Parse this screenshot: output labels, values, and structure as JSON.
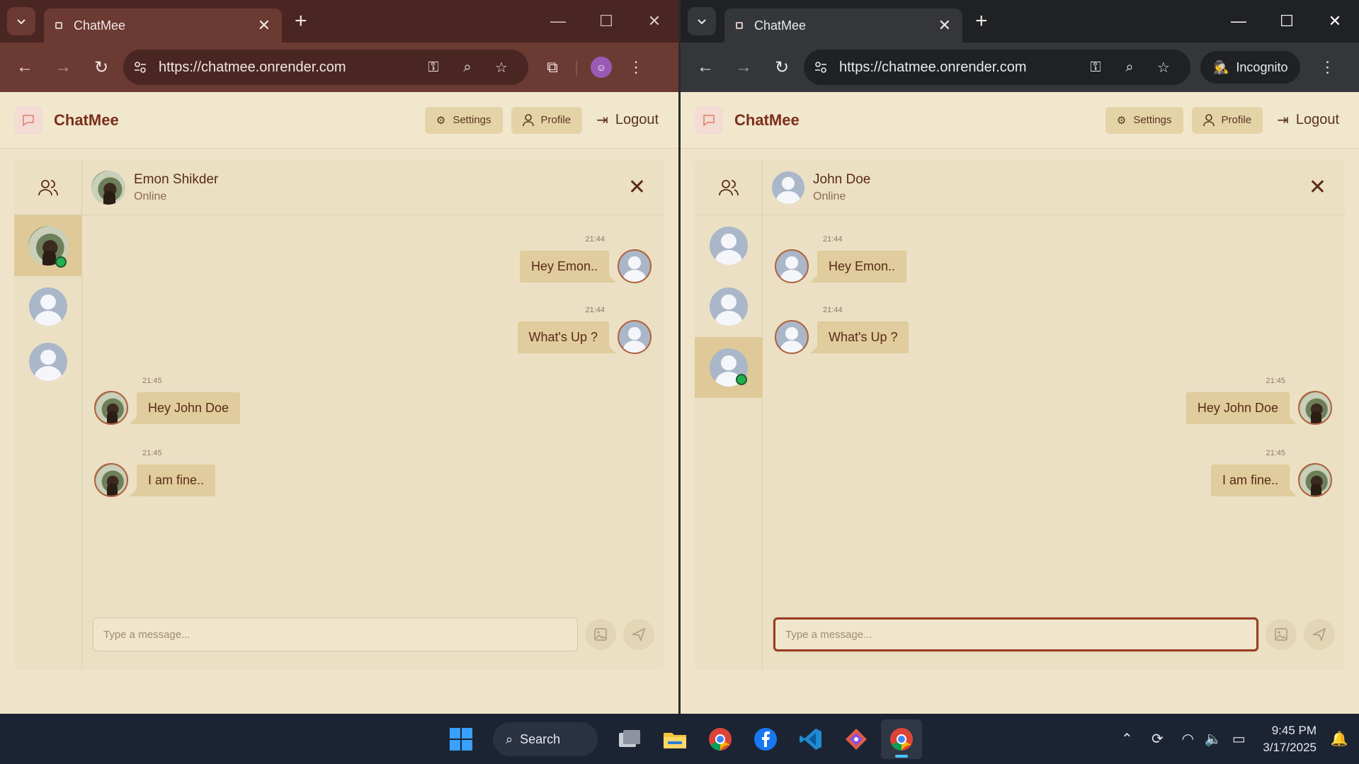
{
  "left_window": {
    "tab_title": "ChatMee",
    "url": "https://chatmee.onrender.com",
    "app": {
      "brand": "ChatMee",
      "settings_label": "Settings",
      "profile_label": "Profile",
      "logout_label": "Logout",
      "chat_name": "Emon Shikder",
      "chat_status": "Online",
      "messages": [
        {
          "time": "21:44",
          "text": "Hey Emon..",
          "dir": "out"
        },
        {
          "time": "21:44",
          "text": "What's Up ?",
          "dir": "out"
        },
        {
          "time": "21:45",
          "text": "Hey John Doe",
          "dir": "in"
        },
        {
          "time": "21:45",
          "text": "I am fine..",
          "dir": "in"
        }
      ],
      "composer_placeholder": "Type a message..."
    }
  },
  "right_window": {
    "tab_title": "ChatMee",
    "url": "https://chatmee.onrender.com",
    "incognito_label": "Incognito",
    "app": {
      "brand": "ChatMee",
      "settings_label": "Settings",
      "profile_label": "Profile",
      "logout_label": "Logout",
      "chat_name": "John Doe",
      "chat_status": "Online",
      "messages": [
        {
          "time": "21:44",
          "text": "Hey Emon..",
          "dir": "in"
        },
        {
          "time": "21:44",
          "text": "What's Up ?",
          "dir": "in"
        },
        {
          "time": "21:45",
          "text": "Hey John Doe",
          "dir": "out"
        },
        {
          "time": "21:45",
          "text": "I am fine..",
          "dir": "out"
        }
      ],
      "composer_placeholder": "Type a message..."
    }
  },
  "taskbar": {
    "search_label": "Search",
    "time": "9:45 PM",
    "date": "3/17/2025"
  },
  "colors": {
    "brand": "#7a2f1a",
    "bubble": "#e0cc9c",
    "online": "#23b04f",
    "left_chrome": "#6b3a33",
    "right_chrome": "#35363a"
  }
}
